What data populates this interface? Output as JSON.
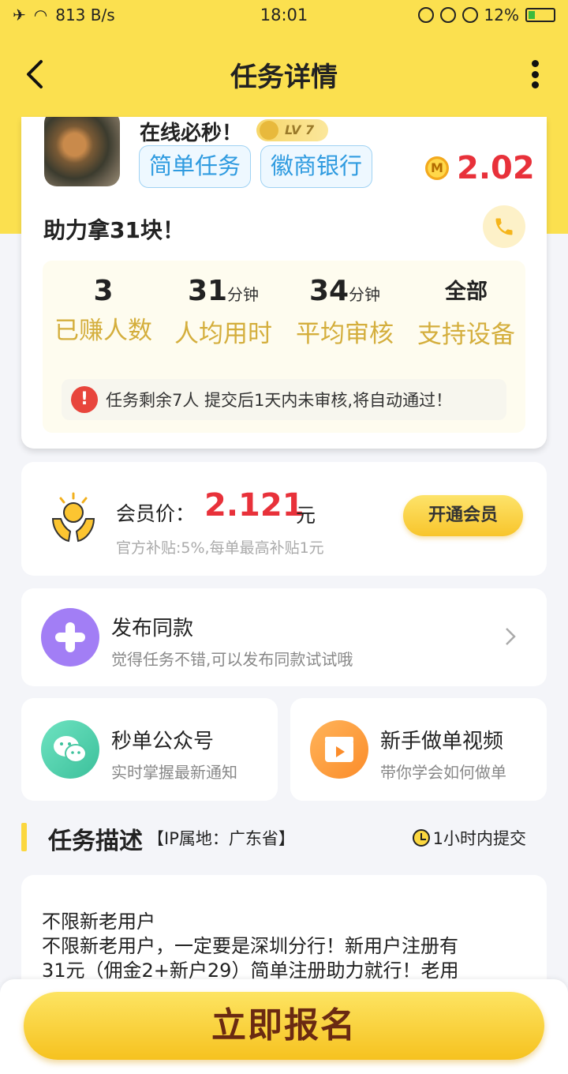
{
  "status_bar": {
    "net_speed": "813 B/s",
    "time": "18:01",
    "battery": "12%"
  },
  "navbar": {
    "title": "任务详情"
  },
  "task": {
    "title": "在线必秒！",
    "level": "LV 7",
    "tags": [
      "简单任务",
      "徽商银行"
    ],
    "coin_letter": "M",
    "price": "2.02",
    "subtitle": "助力拿31块！",
    "stats": [
      {
        "value": "3",
        "unit": "",
        "label": "已赚人数"
      },
      {
        "value": "31",
        "unit": "分钟",
        "label": "人均用时"
      },
      {
        "value": "34",
        "unit": "分钟",
        "label": "平均审核"
      },
      {
        "value": "全部",
        "unit": "",
        "label": "支持设备"
      }
    ],
    "warning": "任务剩余7人  提交后1天内未审核,将自动通过！"
  },
  "member": {
    "label": "会员价：",
    "price": "2.121",
    "unit": "元",
    "note": "官方补贴:5%,每单最高补贴1元",
    "button": "开通会员"
  },
  "publish": {
    "title": "发布同款",
    "desc": "觉得任务不错,可以发布同款试试哦"
  },
  "cards": {
    "wechat_title": "秒单公众号",
    "wechat_desc": "实时掌握最新通知",
    "video_title": "新手做单视频",
    "video_desc": "带你学会如何做单"
  },
  "description": {
    "title": "任务描述",
    "ip": "【IP属地：广东省】",
    "time_limit": "1小时内提交",
    "lines": [
      "不限新老用户",
      "不限新老用户，一定要是深圳分行！新用户注册有",
      "31元（佣金2+新户29）简单注册助力就行！老用"
    ]
  },
  "bottom": {
    "signup": "立即报名"
  },
  "colors": {
    "brand_yellow": "#fbe04f",
    "price_red": "#e8313a",
    "tag_blue": "#2f9be0",
    "gold": "#d4ae3c"
  }
}
